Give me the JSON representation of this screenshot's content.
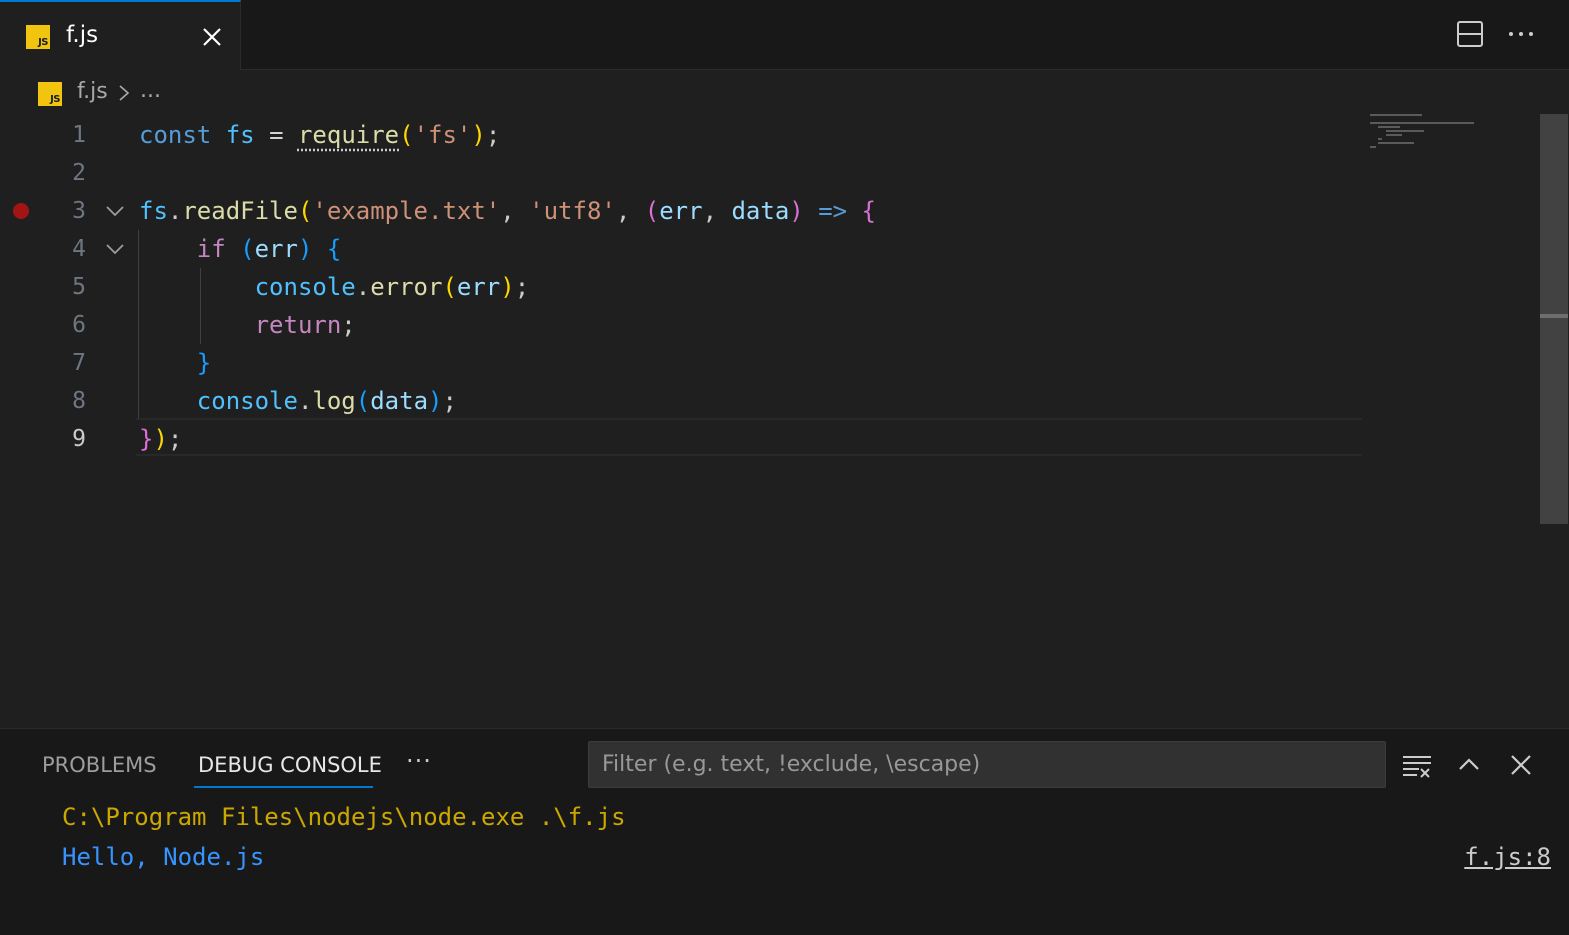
{
  "tab": {
    "label": "f.js",
    "icon": "js-file-icon",
    "badge": "JS"
  },
  "toolbar": {
    "split_icon": "split-editor-icon",
    "more_icon": "more-actions-icon"
  },
  "breadcrumb": {
    "file": "f.js",
    "more": "..."
  },
  "editor": {
    "active_line": 9,
    "breakpoint_line": 3,
    "line_numbers": [
      "1",
      "2",
      "3",
      "4",
      "5",
      "6",
      "7",
      "8",
      "9"
    ],
    "lines": [
      "const fs = require('fs');",
      "",
      "fs.readFile('example.txt', 'utf8', (err, data) => {",
      "    if (err) {",
      "        console.error(err);",
      "        return;",
      "    }",
      "    console.log(data);",
      "});"
    ]
  },
  "panel": {
    "tabs": [
      {
        "label": "PROBLEMS",
        "active": false
      },
      {
        "label": "DEBUG CONSOLE",
        "active": true
      }
    ],
    "more": "···",
    "filter_placeholder": "Filter (e.g. text, !exclude, \\escape)",
    "output": [
      {
        "text": "C:\\Program Files\\nodejs\\node.exe .\\f.js",
        "color": "#cca700"
      },
      {
        "text": "Hello, Node.js",
        "color": "#3794ff",
        "source": "f.js:8"
      }
    ]
  },
  "colors": {
    "accent": "#0078d4",
    "breakpoint": "#a31515",
    "js_badge": "#f1c40f"
  }
}
